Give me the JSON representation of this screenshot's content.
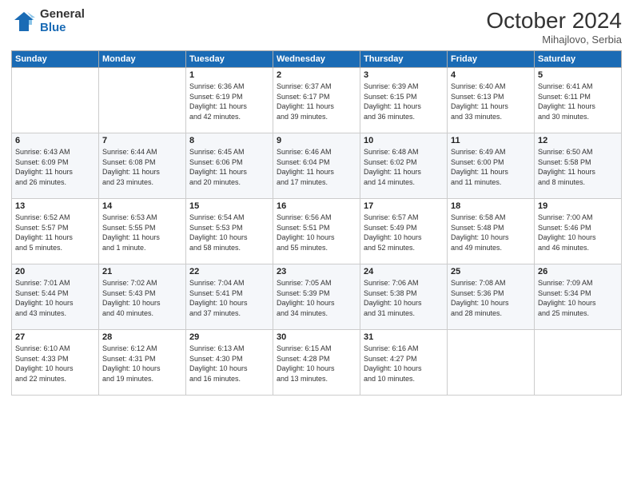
{
  "header": {
    "logo_general": "General",
    "logo_blue": "Blue",
    "month_title": "October 2024",
    "location": "Mihajlovo, Serbia"
  },
  "weekdays": [
    "Sunday",
    "Monday",
    "Tuesday",
    "Wednesday",
    "Thursday",
    "Friday",
    "Saturday"
  ],
  "weeks": [
    [
      {
        "day": "",
        "info": ""
      },
      {
        "day": "",
        "info": ""
      },
      {
        "day": "1",
        "info": "Sunrise: 6:36 AM\nSunset: 6:19 PM\nDaylight: 11 hours\nand 42 minutes."
      },
      {
        "day": "2",
        "info": "Sunrise: 6:37 AM\nSunset: 6:17 PM\nDaylight: 11 hours\nand 39 minutes."
      },
      {
        "day": "3",
        "info": "Sunrise: 6:39 AM\nSunset: 6:15 PM\nDaylight: 11 hours\nand 36 minutes."
      },
      {
        "day": "4",
        "info": "Sunrise: 6:40 AM\nSunset: 6:13 PM\nDaylight: 11 hours\nand 33 minutes."
      },
      {
        "day": "5",
        "info": "Sunrise: 6:41 AM\nSunset: 6:11 PM\nDaylight: 11 hours\nand 30 minutes."
      }
    ],
    [
      {
        "day": "6",
        "info": "Sunrise: 6:43 AM\nSunset: 6:09 PM\nDaylight: 11 hours\nand 26 minutes."
      },
      {
        "day": "7",
        "info": "Sunrise: 6:44 AM\nSunset: 6:08 PM\nDaylight: 11 hours\nand 23 minutes."
      },
      {
        "day": "8",
        "info": "Sunrise: 6:45 AM\nSunset: 6:06 PM\nDaylight: 11 hours\nand 20 minutes."
      },
      {
        "day": "9",
        "info": "Sunrise: 6:46 AM\nSunset: 6:04 PM\nDaylight: 11 hours\nand 17 minutes."
      },
      {
        "day": "10",
        "info": "Sunrise: 6:48 AM\nSunset: 6:02 PM\nDaylight: 11 hours\nand 14 minutes."
      },
      {
        "day": "11",
        "info": "Sunrise: 6:49 AM\nSunset: 6:00 PM\nDaylight: 11 hours\nand 11 minutes."
      },
      {
        "day": "12",
        "info": "Sunrise: 6:50 AM\nSunset: 5:58 PM\nDaylight: 11 hours\nand 8 minutes."
      }
    ],
    [
      {
        "day": "13",
        "info": "Sunrise: 6:52 AM\nSunset: 5:57 PM\nDaylight: 11 hours\nand 5 minutes."
      },
      {
        "day": "14",
        "info": "Sunrise: 6:53 AM\nSunset: 5:55 PM\nDaylight: 11 hours\nand 1 minute."
      },
      {
        "day": "15",
        "info": "Sunrise: 6:54 AM\nSunset: 5:53 PM\nDaylight: 10 hours\nand 58 minutes."
      },
      {
        "day": "16",
        "info": "Sunrise: 6:56 AM\nSunset: 5:51 PM\nDaylight: 10 hours\nand 55 minutes."
      },
      {
        "day": "17",
        "info": "Sunrise: 6:57 AM\nSunset: 5:49 PM\nDaylight: 10 hours\nand 52 minutes."
      },
      {
        "day": "18",
        "info": "Sunrise: 6:58 AM\nSunset: 5:48 PM\nDaylight: 10 hours\nand 49 minutes."
      },
      {
        "day": "19",
        "info": "Sunrise: 7:00 AM\nSunset: 5:46 PM\nDaylight: 10 hours\nand 46 minutes."
      }
    ],
    [
      {
        "day": "20",
        "info": "Sunrise: 7:01 AM\nSunset: 5:44 PM\nDaylight: 10 hours\nand 43 minutes."
      },
      {
        "day": "21",
        "info": "Sunrise: 7:02 AM\nSunset: 5:43 PM\nDaylight: 10 hours\nand 40 minutes."
      },
      {
        "day": "22",
        "info": "Sunrise: 7:04 AM\nSunset: 5:41 PM\nDaylight: 10 hours\nand 37 minutes."
      },
      {
        "day": "23",
        "info": "Sunrise: 7:05 AM\nSunset: 5:39 PM\nDaylight: 10 hours\nand 34 minutes."
      },
      {
        "day": "24",
        "info": "Sunrise: 7:06 AM\nSunset: 5:38 PM\nDaylight: 10 hours\nand 31 minutes."
      },
      {
        "day": "25",
        "info": "Sunrise: 7:08 AM\nSunset: 5:36 PM\nDaylight: 10 hours\nand 28 minutes."
      },
      {
        "day": "26",
        "info": "Sunrise: 7:09 AM\nSunset: 5:34 PM\nDaylight: 10 hours\nand 25 minutes."
      }
    ],
    [
      {
        "day": "27",
        "info": "Sunrise: 6:10 AM\nSunset: 4:33 PM\nDaylight: 10 hours\nand 22 minutes."
      },
      {
        "day": "28",
        "info": "Sunrise: 6:12 AM\nSunset: 4:31 PM\nDaylight: 10 hours\nand 19 minutes."
      },
      {
        "day": "29",
        "info": "Sunrise: 6:13 AM\nSunset: 4:30 PM\nDaylight: 10 hours\nand 16 minutes."
      },
      {
        "day": "30",
        "info": "Sunrise: 6:15 AM\nSunset: 4:28 PM\nDaylight: 10 hours\nand 13 minutes."
      },
      {
        "day": "31",
        "info": "Sunrise: 6:16 AM\nSunset: 4:27 PM\nDaylight: 10 hours\nand 10 minutes."
      },
      {
        "day": "",
        "info": ""
      },
      {
        "day": "",
        "info": ""
      }
    ]
  ]
}
